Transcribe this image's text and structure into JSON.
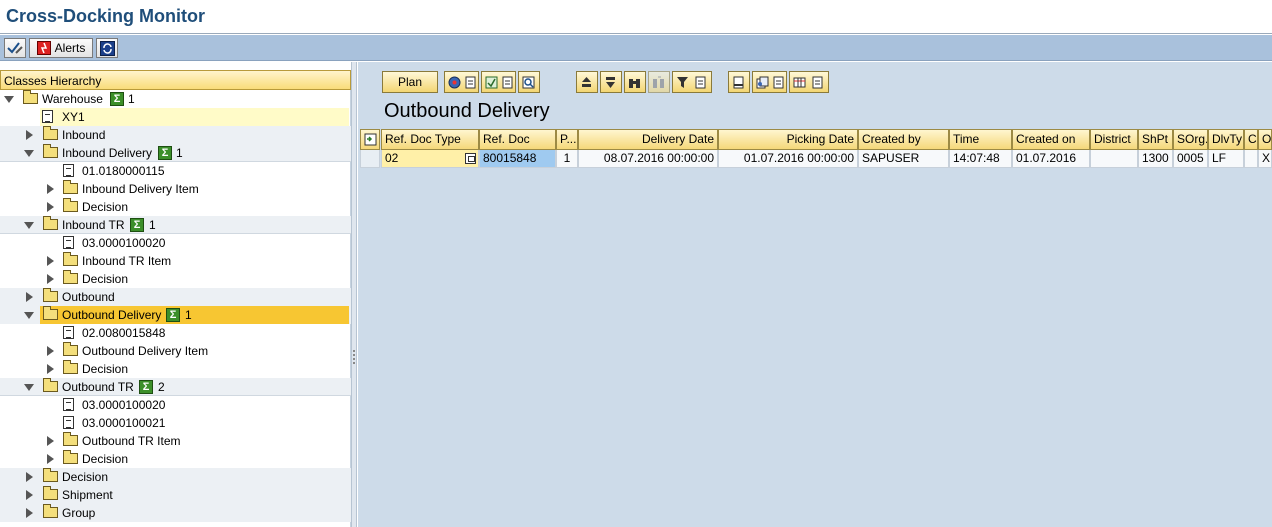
{
  "window": {
    "title": "Cross-Docking Monitor"
  },
  "app_toolbar": {
    "alerts_label": "Alerts"
  },
  "tree": {
    "header": "Classes Hierarchy",
    "rows": [
      {
        "label": "Warehouse",
        "count": "1"
      },
      {
        "label": "XY1"
      },
      {
        "label": "Inbound"
      },
      {
        "label": "Inbound Delivery",
        "count": "1"
      },
      {
        "label": "01.0180000115"
      },
      {
        "label": "Inbound Delivery Item"
      },
      {
        "label": "Decision"
      },
      {
        "label": "Inbound TR",
        "count": "1"
      },
      {
        "label": "03.0000100020"
      },
      {
        "label": "Inbound TR Item"
      },
      {
        "label": "Decision"
      },
      {
        "label": "Outbound"
      },
      {
        "label": "Outbound Delivery",
        "count": "1"
      },
      {
        "label": "02.0080015848"
      },
      {
        "label": "Outbound Delivery Item"
      },
      {
        "label": "Decision"
      },
      {
        "label": "Outbound TR",
        "count": "2"
      },
      {
        "label": "03.0000100020"
      },
      {
        "label": "03.0000100021"
      },
      {
        "label": "Outbound TR Item"
      },
      {
        "label": "Decision"
      },
      {
        "label": "Decision"
      },
      {
        "label": "Shipment"
      },
      {
        "label": "Group"
      }
    ]
  },
  "alv": {
    "plan_label": "Plan",
    "title": "Outbound Delivery",
    "columns": [
      "Ref. Doc Type",
      "Ref. Doc",
      "P...",
      "Delivery Date",
      "Picking Date",
      "Created by",
      "Time",
      "Created on",
      "District",
      "ShPt",
      "SOrg.",
      "DlvTy",
      "C",
      "O"
    ],
    "rows": [
      [
        "02",
        "80015848",
        "1",
        "08.07.2016 00:00:00",
        "01.07.2016 00:00:00",
        "SAPUSER",
        "14:07:48",
        "01.07.2016",
        "",
        "1300",
        "0005",
        "LF",
        "",
        "X"
      ]
    ]
  },
  "colors": {
    "title": "#1f4e7a",
    "toolbar_bg": "#a9c1dc",
    "pane_bg": "#cddbe9",
    "selected_node": "#f7c632",
    "header_cell": "#f5d87a"
  }
}
